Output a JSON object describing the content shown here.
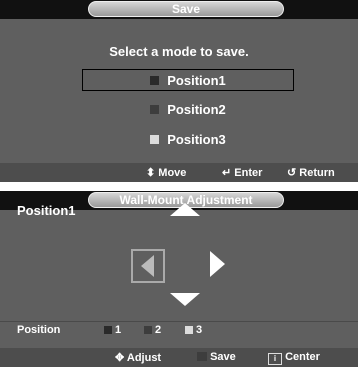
{
  "save_panel": {
    "title": "Save",
    "prompt": "Select a mode to save.",
    "options": [
      {
        "label": "Position1",
        "color": "#2a2a2a"
      },
      {
        "label": "Position2",
        "color": "#3d3d3d"
      },
      {
        "label": "Position3",
        "color": "#dcdcdc"
      }
    ],
    "hints": {
      "move": "Move",
      "enter": "Enter",
      "return": "Return"
    }
  },
  "wall_mount_panel": {
    "title": "Wall-Mount Adjustment",
    "current_position": "Position1",
    "legend_label": "Position",
    "legend_items": [
      {
        "num": "1",
        "color": "#2a2a2a"
      },
      {
        "num": "2",
        "color": "#3d3d3d"
      },
      {
        "num": "3",
        "color": "#dcdcdc"
      }
    ],
    "hints": {
      "adjust": "Adjust",
      "save": "Save",
      "center": "Center"
    }
  },
  "colors": {
    "panel_bg": "#5f5f5f",
    "title_bar": "#111111",
    "selection_border": "#000000"
  }
}
